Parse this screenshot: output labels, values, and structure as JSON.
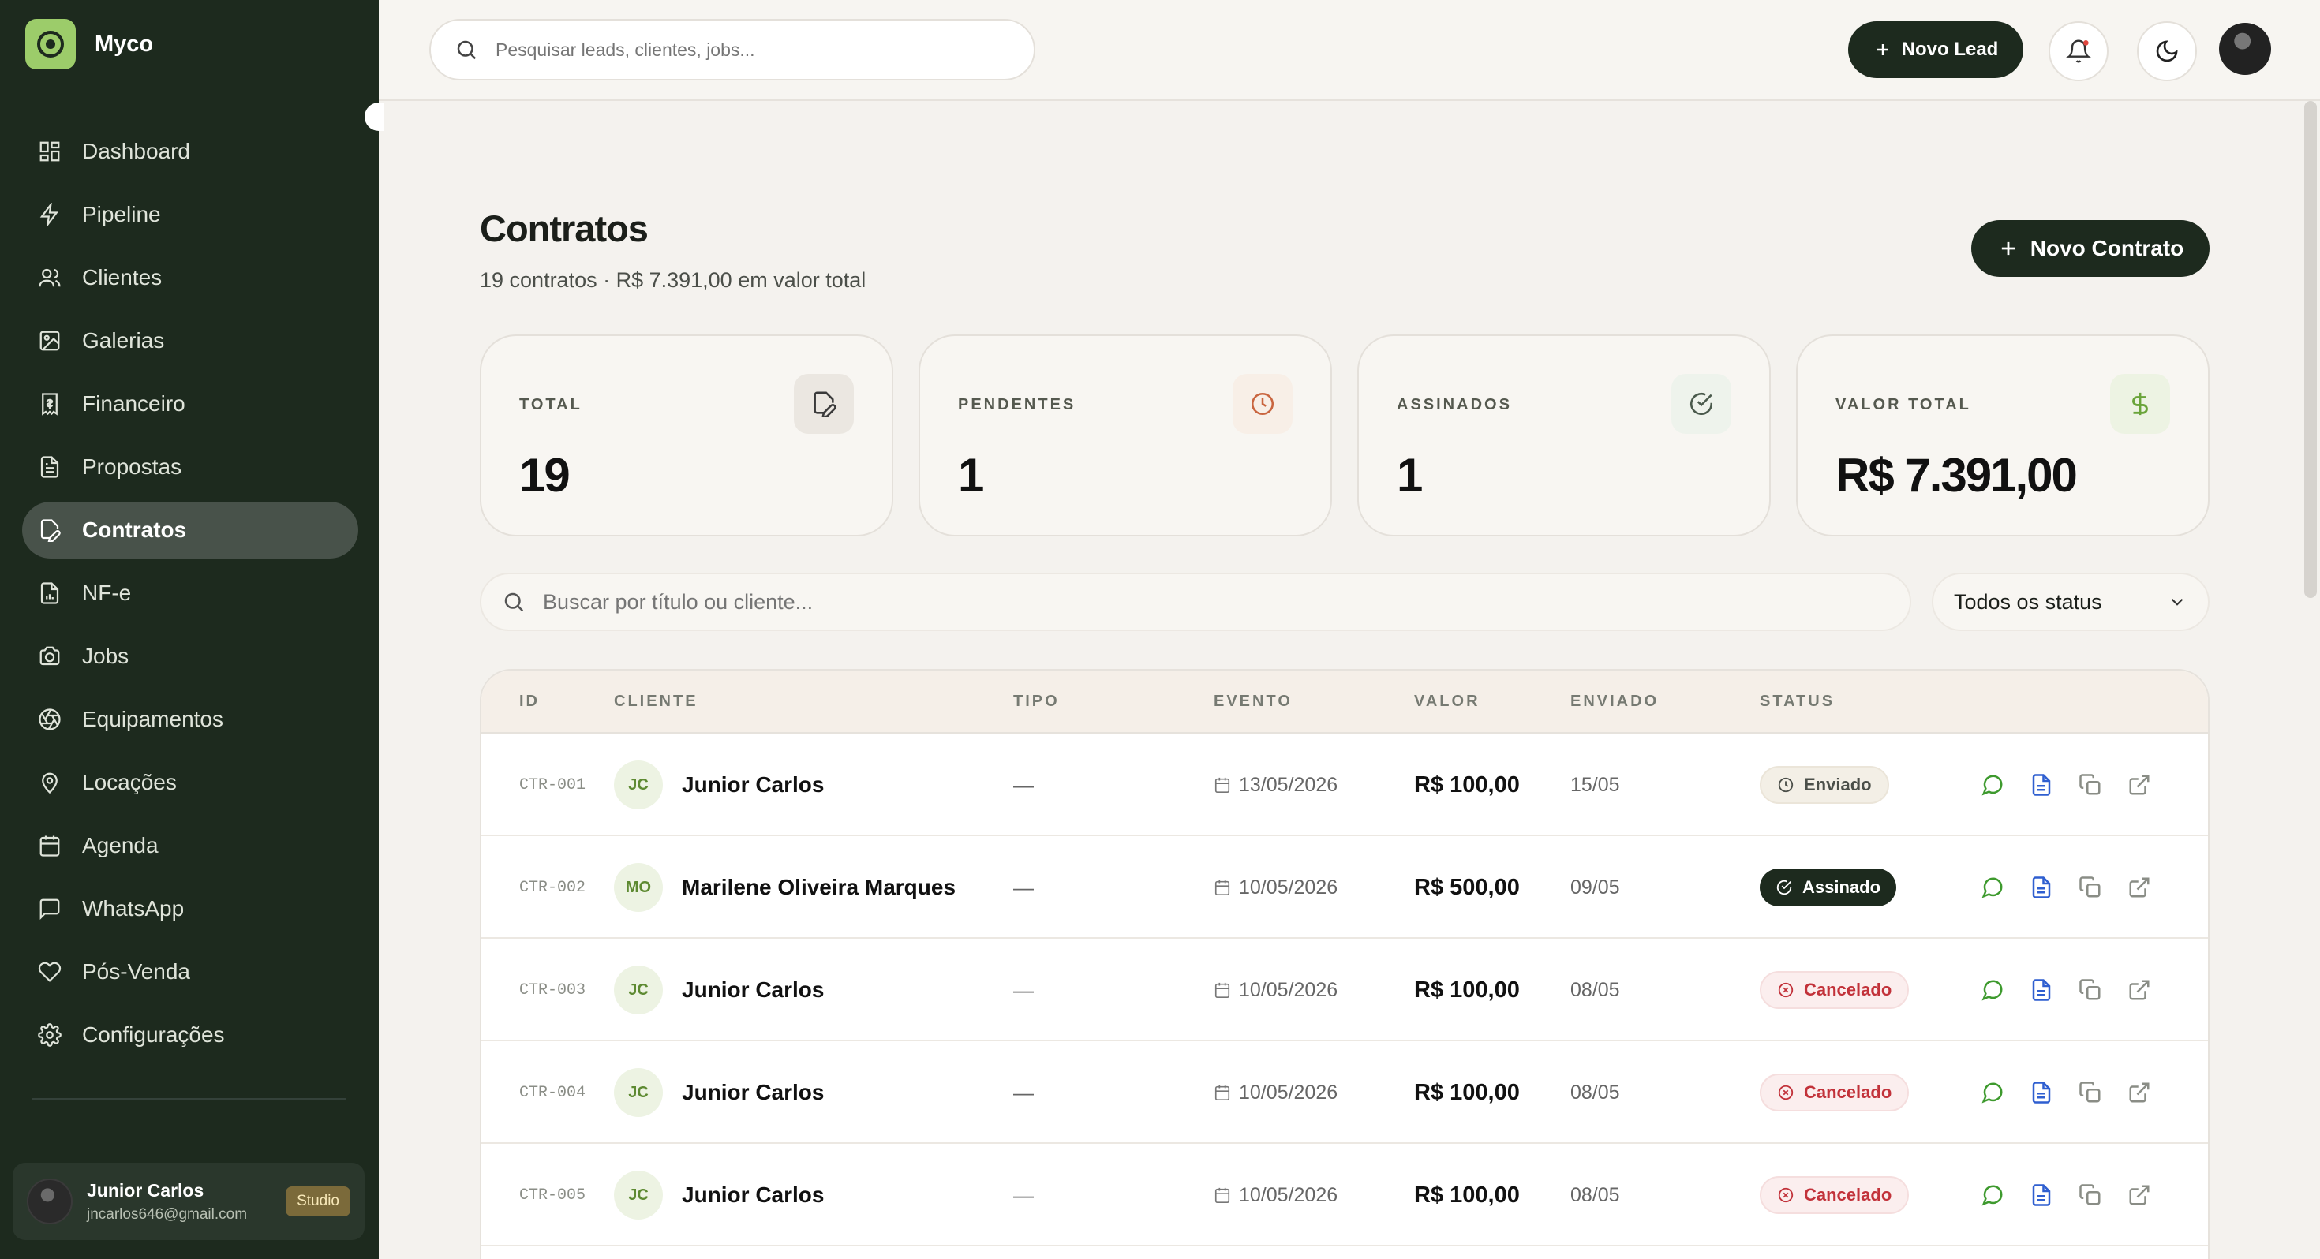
{
  "brand": {
    "name": "Myco"
  },
  "sidebar": {
    "items": [
      {
        "label": "Dashboard",
        "icon": "dashboard-icon"
      },
      {
        "label": "Pipeline",
        "icon": "lightning-icon"
      },
      {
        "label": "Clientes",
        "icon": "users-icon"
      },
      {
        "label": "Galerias",
        "icon": "image-icon"
      },
      {
        "label": "Financeiro",
        "icon": "receipt-icon"
      },
      {
        "label": "Propostas",
        "icon": "document-icon"
      },
      {
        "label": "Contratos",
        "icon": "edit-document-icon",
        "active": true
      },
      {
        "label": "NF-e",
        "icon": "invoice-icon"
      },
      {
        "label": "Jobs",
        "icon": "camera-icon"
      },
      {
        "label": "Equipamentos",
        "icon": "aperture-icon"
      },
      {
        "label": "Locações",
        "icon": "map-pin-icon"
      },
      {
        "label": "Agenda",
        "icon": "calendar-icon"
      },
      {
        "label": "WhatsApp",
        "icon": "chat-icon"
      },
      {
        "label": "Pós-Venda",
        "icon": "heart-icon"
      },
      {
        "label": "Configurações",
        "icon": "gear-icon"
      }
    ],
    "user": {
      "name": "Junior Carlos",
      "email": "jncarlos646@gmail.com",
      "plan": "Studio"
    }
  },
  "topbar": {
    "search_placeholder": "Pesquisar leads, clientes, jobs...",
    "new_lead_label": "Novo Lead"
  },
  "page": {
    "title": "Contratos",
    "subtitle": "19 contratos · R$ 7.391,00 em valor total",
    "new_contract_label": "Novo Contrato"
  },
  "stats": [
    {
      "label": "TOTAL",
      "value": "19",
      "icon": "edit-document-icon",
      "icon_color": "#3a3a3a",
      "icon_bg": "#ebe7e1"
    },
    {
      "label": "PENDENTES",
      "value": "1",
      "icon": "clock-icon",
      "icon_color": "#c9653f",
      "icon_bg": "#f8efe7"
    },
    {
      "label": "ASSINADOS",
      "value": "1",
      "icon": "check-circle-icon",
      "icon_color": "#4a5a4c",
      "icon_bg": "#eef3ec"
    },
    {
      "label": "VALOR TOTAL",
      "value": "R$ 7.391,00",
      "icon": "dollar-icon",
      "icon_color": "#6aa43a",
      "icon_bg": "#edf3e3"
    }
  ],
  "filters": {
    "search_placeholder": "Buscar por título ou cliente...",
    "status_selected": "Todos os status"
  },
  "table": {
    "headers": [
      "ID",
      "CLIENTE",
      "TIPO",
      "EVENTO",
      "VALOR",
      "ENVIADO",
      "STATUS"
    ],
    "rows": [
      {
        "id": "CTR-001",
        "initials": "JC",
        "client": "Junior Carlos",
        "tipo": "—",
        "evento": "13/05/2026",
        "valor": "R$ 100,00",
        "enviado": "15/05",
        "status": "Enviado",
        "status_kind": "enviado"
      },
      {
        "id": "CTR-002",
        "initials": "MO",
        "client": "Marilene Oliveira Marques",
        "tipo": "—",
        "evento": "10/05/2026",
        "valor": "R$ 500,00",
        "enviado": "09/05",
        "status": "Assinado",
        "status_kind": "assinado"
      },
      {
        "id": "CTR-003",
        "initials": "JC",
        "client": "Junior Carlos",
        "tipo": "—",
        "evento": "10/05/2026",
        "valor": "R$ 100,00",
        "enviado": "08/05",
        "status": "Cancelado",
        "status_kind": "cancelado"
      },
      {
        "id": "CTR-004",
        "initials": "JC",
        "client": "Junior Carlos",
        "tipo": "—",
        "evento": "10/05/2026",
        "valor": "R$ 100,00",
        "enviado": "08/05",
        "status": "Cancelado",
        "status_kind": "cancelado"
      },
      {
        "id": "CTR-005",
        "initials": "JC",
        "client": "Junior Carlos",
        "tipo": "—",
        "evento": "10/05/2026",
        "valor": "R$ 100,00",
        "enviado": "08/05",
        "status": "Cancelado",
        "status_kind": "cancelado"
      }
    ]
  },
  "colors": {
    "sidebar_bg": "#1d2a1e",
    "accent": "#9ccc6a",
    "danger": "#c2323a"
  }
}
